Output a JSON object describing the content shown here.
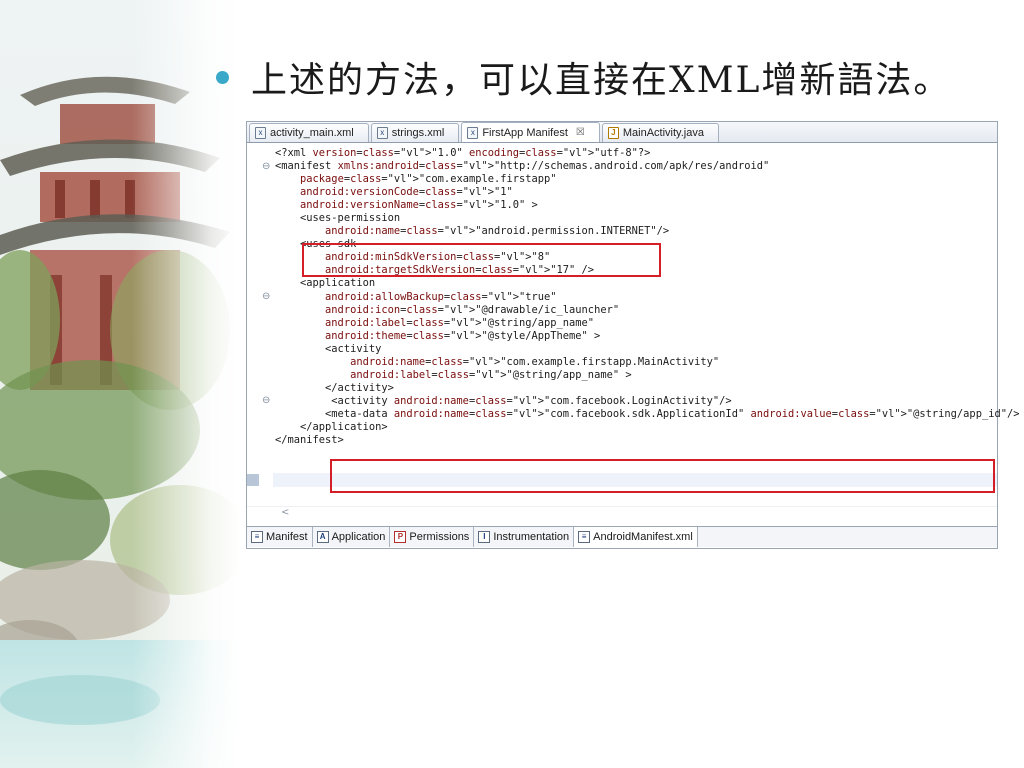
{
  "slide": {
    "title": "上述的方法，可以直接在XML增新語法。"
  },
  "editor": {
    "tabs": [
      {
        "label": "activity_main.xml",
        "icon": "xml-file-icon"
      },
      {
        "label": "strings.xml",
        "icon": "xml-file-icon"
      },
      {
        "label": "FirstApp Manifest",
        "icon": "manifest-icon",
        "close": "☒"
      },
      {
        "label": "MainActivity.java",
        "icon": "java-file-icon"
      }
    ],
    "bottom_tabs": [
      {
        "label": "Manifest",
        "icon_char": "≡"
      },
      {
        "label": "Application",
        "icon_char": "A"
      },
      {
        "label": "Permissions",
        "icon_char": "P"
      },
      {
        "label": "Instrumentation",
        "icon_char": "I"
      },
      {
        "label": "AndroidManifest.xml",
        "icon_char": "≡"
      }
    ],
    "highlight_color": "#d41f28",
    "code": {
      "l1": "<?xml version=\"1.0\" encoding=\"utf-8\"?>",
      "l2": "<manifest xmlns:android=\"http://schemas.android.com/apk/res/android\"",
      "l3": "    package=\"com.example.firstapp\"",
      "l4": "    android:versionCode=\"1\"",
      "l5": "    android:versionName=\"1.0\" >",
      "l6": "    <uses-permission",
      "l7": "        android:name=\"android.permission.INTERNET\"/>",
      "l8": "    <uses-sdk",
      "l9": "        android:minSdkVersion=\"8\"",
      "l10": "        android:targetSdkVersion=\"17\" />",
      "l11": "    <application",
      "l12": "        android:allowBackup=\"true\"",
      "l13": "        android:icon=\"@drawable/ic_launcher\"",
      "l14": "        android:label=\"@string/app_name\"",
      "l15": "        android:theme=\"@style/AppTheme\" >",
      "l16": "        <activity",
      "l17": "            android:name=\"com.example.firstapp.MainActivity\"",
      "l18": "            android:label=\"@string/app_name\" >",
      "l19": "        </activity>",
      "l20": "         <activity android:name=\"com.facebook.LoginActivity\"/>",
      "l21": "        <meta-data android:name=\"com.facebook.sdk.ApplicationId\" android:value=\"@string/app_id\"/>",
      "l22": "    </application>",
      "l23": "</manifest>"
    }
  }
}
